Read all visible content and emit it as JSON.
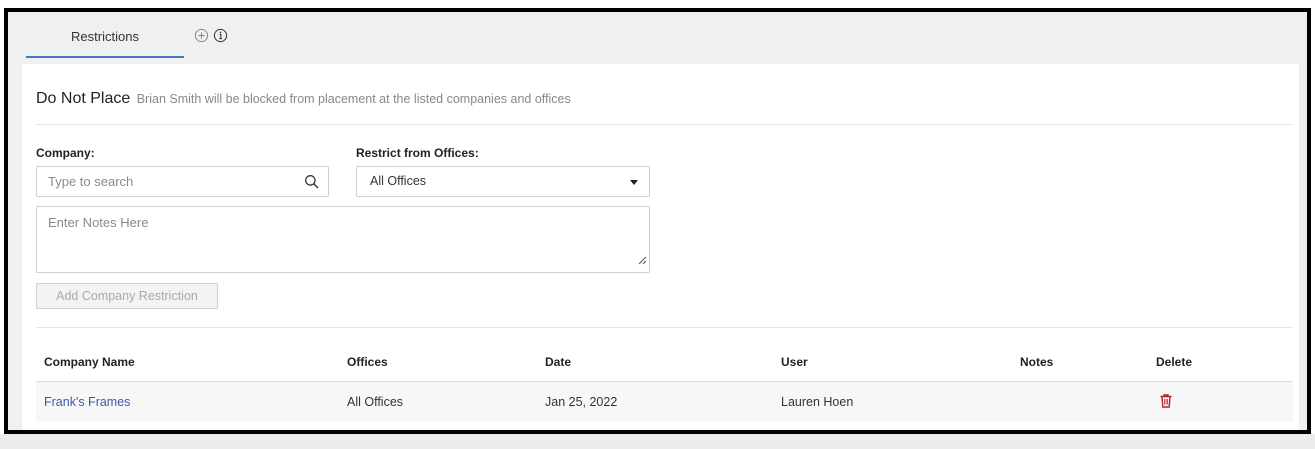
{
  "tabs": [
    {
      "label": "Restrictions",
      "active": true
    }
  ],
  "tab_icons": [
    "plus-circle-icon",
    "info-icon"
  ],
  "section": {
    "title": "Do Not Place",
    "subtitle": "Brian Smith will be blocked from placement at the listed companies and offices"
  },
  "form": {
    "company_label": "Company:",
    "company_placeholder": "Type to search",
    "company_value": "",
    "offices_label": "Restrict from Offices:",
    "offices_value": "All Offices",
    "notes_placeholder": "Enter Notes Here",
    "notes_value": "",
    "add_button_label": "Add Company Restriction",
    "add_button_disabled": true
  },
  "table": {
    "columns": [
      "Company Name",
      "Offices",
      "Date",
      "User",
      "Notes",
      "Delete"
    ],
    "rows": [
      {
        "company_name": "Frank's Frames",
        "offices": "All Offices",
        "date": "Jan 25, 2022",
        "user": "Lauren Hoen",
        "notes": "",
        "delete_icon": "trash-icon"
      }
    ]
  },
  "colors": {
    "accent": "#4a76c9",
    "link": "#3b5bb0",
    "delete": "#b3242b",
    "background": "#f0f0f0",
    "muted_text": "#888888"
  }
}
